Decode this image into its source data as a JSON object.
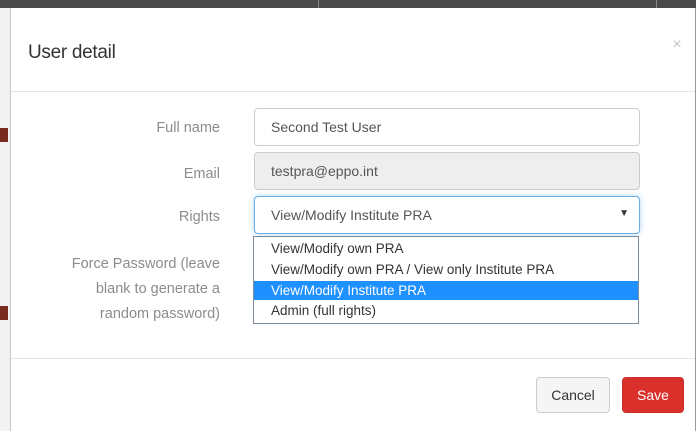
{
  "modal": {
    "title": "User detail",
    "close_symbol": "×"
  },
  "form": {
    "full_name": {
      "label": "Full name",
      "value": "Second Test User"
    },
    "email": {
      "label": "Email",
      "value": "testpra@eppo.int"
    },
    "rights": {
      "label": "Rights",
      "selected": "View/Modify Institute PRA",
      "options": [
        "View/Modify own PRA",
        "View/Modify own PRA / View only Institute PRA",
        "View/Modify Institute PRA",
        "Admin (full rights)"
      ],
      "highlighted_index": 2
    },
    "force_password": {
      "label_lines": [
        "Force Password (leave",
        "blank to generate a",
        "random password)"
      ]
    }
  },
  "footer": {
    "cancel_label": "Cancel",
    "save_label": "Save"
  },
  "colors": {
    "save_button": "#d9302c",
    "dropdown_highlight": "#1e90ff",
    "focus_border": "#66afe9"
  },
  "icons": {
    "close": "close-icon",
    "select_arrow": "caret-down-icon"
  }
}
